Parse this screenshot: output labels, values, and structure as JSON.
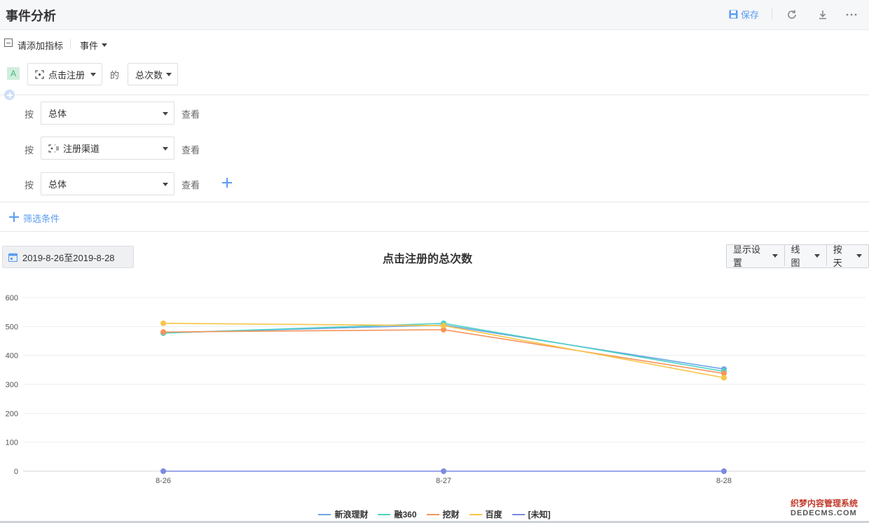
{
  "header": {
    "title": "事件分析",
    "save_label": "保存"
  },
  "metric_bar": {
    "add_metric_label": "请添加指标",
    "event_menu_label": "事件"
  },
  "metric": {
    "badge": "A",
    "event_value": "点击注册",
    "connector": "的",
    "aggregation_value": "总次数"
  },
  "group_rows": [
    {
      "prefix": "按",
      "value": "总体",
      "suffix": "查看"
    },
    {
      "prefix": "按",
      "value": "注册渠道",
      "suffix": "查看"
    },
    {
      "prefix": "按",
      "value": "总体",
      "suffix": "查看"
    }
  ],
  "filter": {
    "label": "筛选条件"
  },
  "chart_toolbar": {
    "date_range": "2019-8-26至2019-8-28",
    "display_settings": "显示设置",
    "chart_kind": "线图",
    "granularity": "按天"
  },
  "chart_data": {
    "type": "line",
    "title": "点击注册的总次数",
    "xlabel": "",
    "ylabel": "",
    "categories": [
      "8-26",
      "8-27",
      "8-28"
    ],
    "ylim": [
      0,
      600
    ],
    "yticks": [
      0,
      100,
      200,
      300,
      400,
      500,
      600
    ],
    "grid": true,
    "legend_position": "bottom",
    "series": [
      {
        "name": "新浪理财",
        "color": "#6aa6e8",
        "values": [
          478,
          505,
          353
        ]
      },
      {
        "name": "融360",
        "color": "#4fd1c5",
        "values": [
          477,
          511,
          345
        ]
      },
      {
        "name": "挖财",
        "color": "#f4945c",
        "values": [
          481,
          489,
          338
        ]
      },
      {
        "name": "百度",
        "color": "#f7c548",
        "values": [
          511,
          503,
          323
        ]
      },
      {
        "name": "[未知]",
        "color": "#7b8ae0",
        "values": [
          0,
          0,
          0
        ]
      }
    ]
  },
  "watermark": {
    "line1": "织梦内容管理系统",
    "line2": "DEDECMS.COM"
  }
}
